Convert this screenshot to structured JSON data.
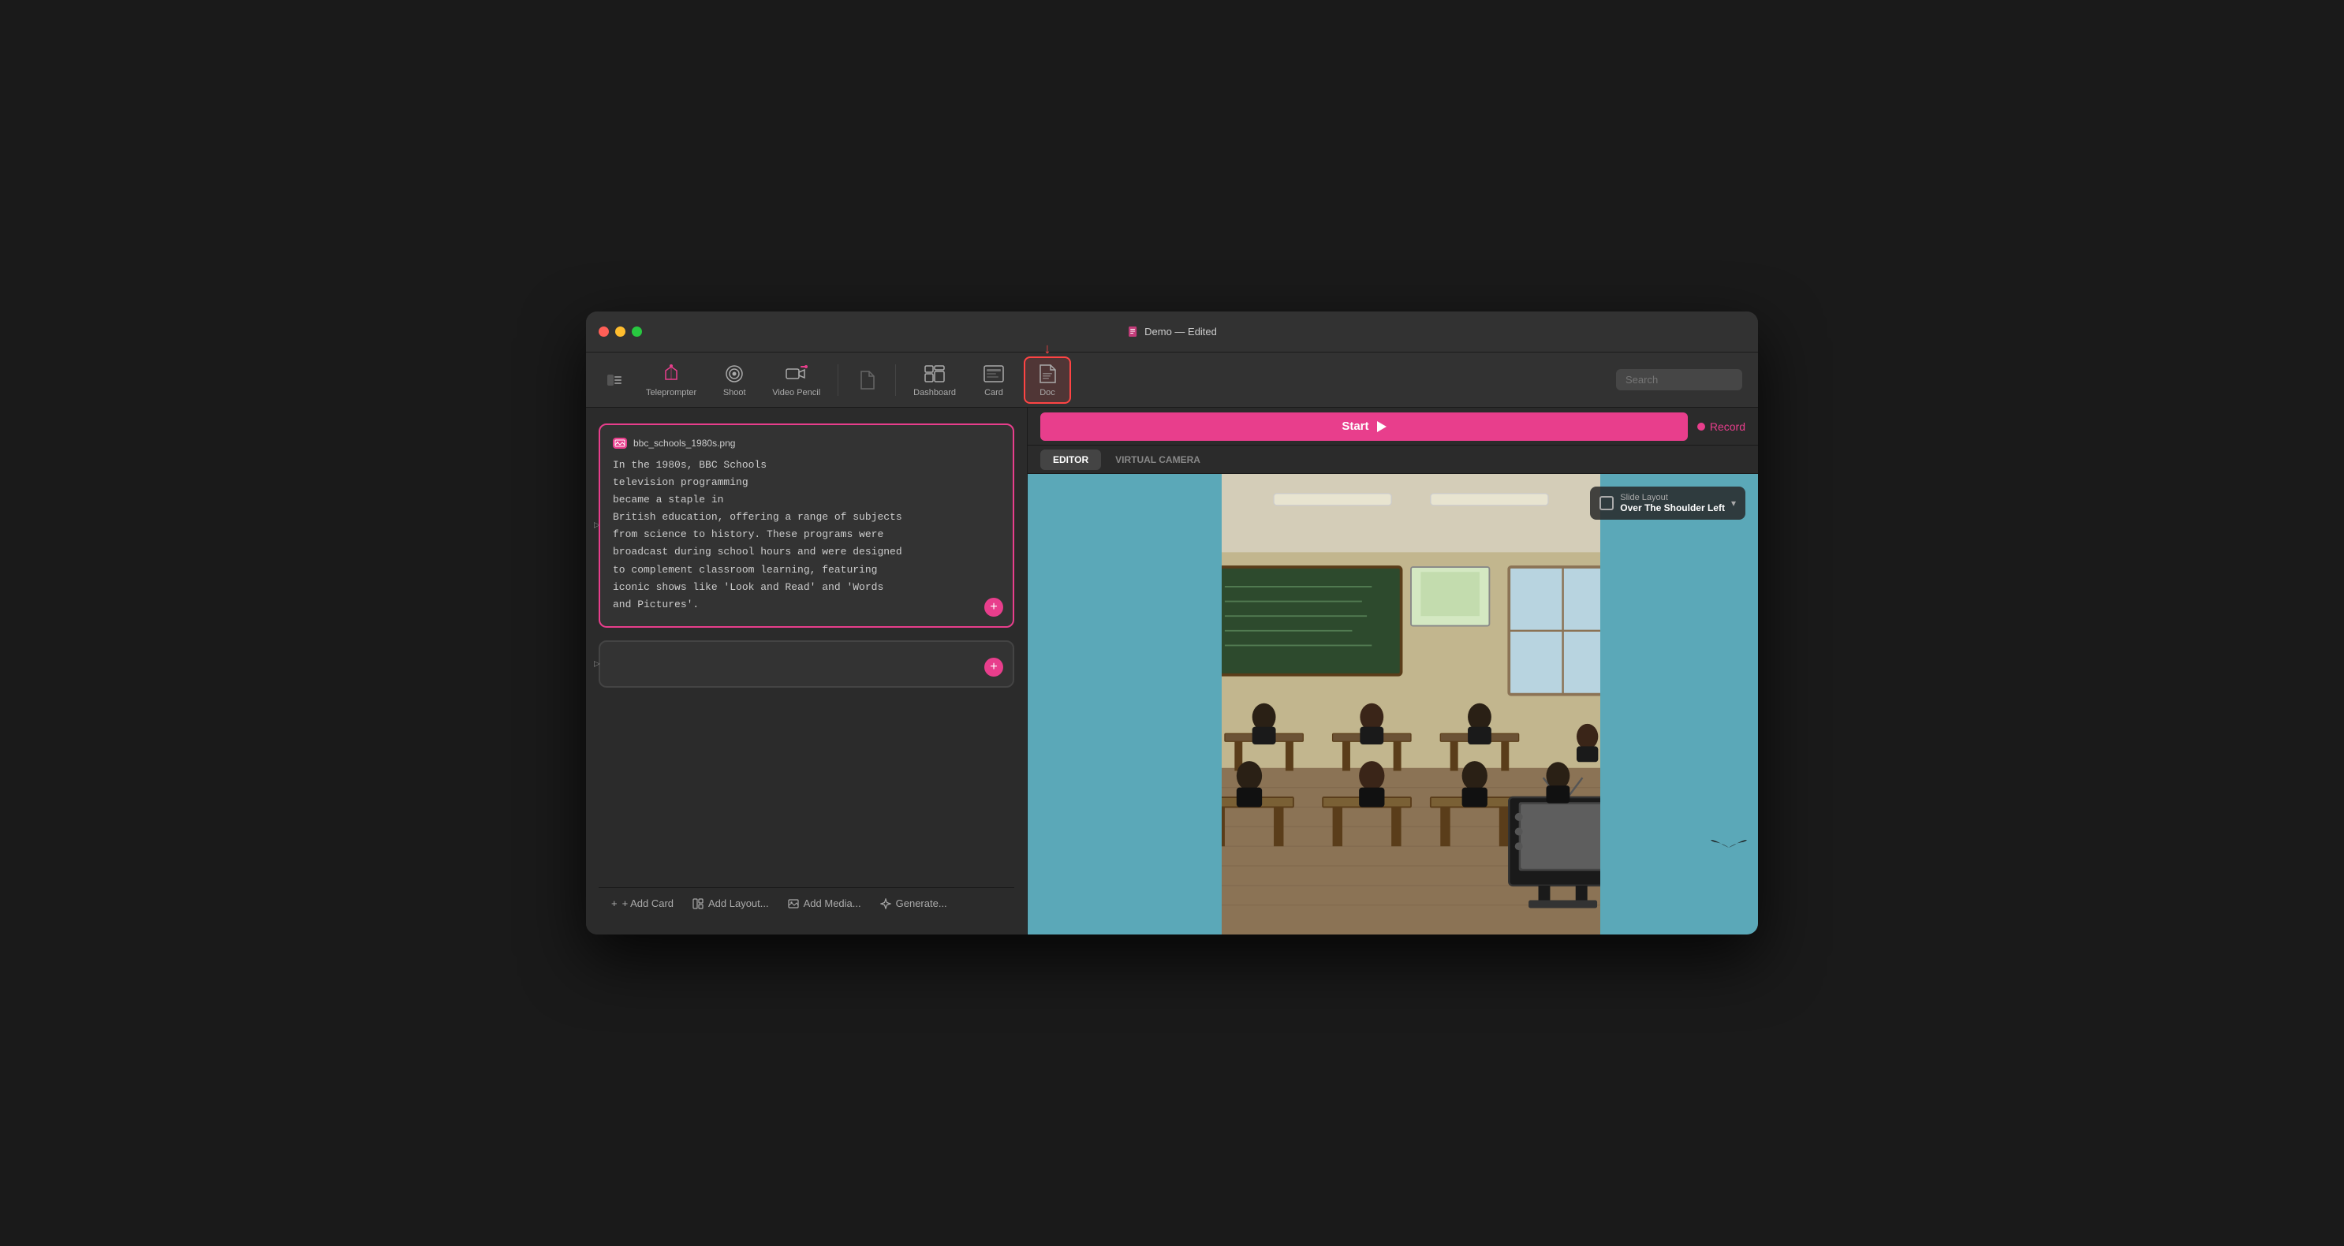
{
  "window": {
    "title": "Demo",
    "subtitle": "Edited"
  },
  "titlebar": {
    "title_text": "Demo — Edited"
  },
  "toolbar": {
    "teleprompter_label": "Teleprompter",
    "shoot_label": "Shoot",
    "video_pencil_label": "Video Pencil",
    "dashboard_label": "Dashboard",
    "card_label": "Card",
    "doc_label": "Doc",
    "search_placeholder": "Search"
  },
  "left_panel": {
    "card1": {
      "filename": "bbc_schools_1980s.png",
      "text": "In the 1980s, BBC Schools\ntelevision programming\nbecame a staple in\nBritish education, offering a range of subjects\nfrom science to history. These programs were\nbroadcast during school hours and were designed\nto complement classroom learning, featuring\niconic shows like 'Look and Read' and 'Words\nand Pictures'."
    },
    "card2": {
      "text": ""
    },
    "bottom_bar": {
      "add_card": "+ Add Card",
      "add_layout": "Add Layout...",
      "add_media": "Add Media...",
      "generate": "Generate..."
    }
  },
  "right_panel": {
    "start_button": "Start",
    "record_label": "Record",
    "tab_editor": "EDITOR",
    "tab_virtual_camera": "VIRTUAL CAMERA",
    "slide_layout_label": "Slide Layout",
    "slide_layout_name": "Over The Shoulder Left"
  }
}
